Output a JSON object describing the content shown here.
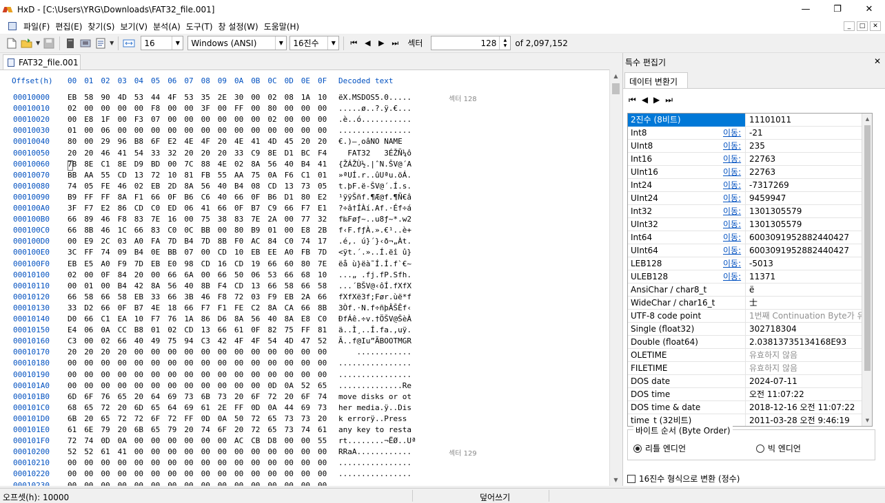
{
  "window": {
    "title": "HxD - [C:\\Users\\YRG\\Downloads\\FAT32_file.001]",
    "minimize": "—",
    "maximize": "❐",
    "close": "✕"
  },
  "menu": {
    "items": [
      "파일(F)",
      "편집(E)",
      "찾기(S)",
      "보기(V)",
      "분석(A)",
      "도구(T)",
      "창 설정(W)",
      "도움말(H)"
    ],
    "mdi": [
      "_",
      "□",
      "✕"
    ]
  },
  "toolbar": {
    "bytes_per_row": "16",
    "charset": "Windows (ANSI)",
    "offset_base": "16진수",
    "sector_label": "섹터",
    "sector_value": "128",
    "sector_total": "of 2,097,152"
  },
  "tab": {
    "label": "FAT32_file.001"
  },
  "hex": {
    "offset_header": "Offset(h)",
    "columns": [
      "00",
      "01",
      "02",
      "03",
      "04",
      "05",
      "06",
      "07",
      "08",
      "09",
      "0A",
      "0B",
      "0C",
      "0D",
      "0E",
      "0F"
    ],
    "decoded_header": "Decoded text",
    "rows": [
      {
        "off": "00010000",
        "b": "EB 58 90 4D 53 44 4F 53 35 2E 30 00 02 08 1A 10",
        "t": "ëX.MSDOS5.0.....",
        "s": "섹터 128"
      },
      {
        "off": "00010010",
        "b": "02 00 00 00 00 F8 00 00 3F 00 FF 00 80 00 00 00",
        "t": ".....ø..?.ÿ.€..."
      },
      {
        "off": "00010020",
        "b": "00 E8 1F 00 F3 07 00 00 00 00 00 00 02 00 00 00",
        "t": ".è..ó..........."
      },
      {
        "off": "00010030",
        "b": "01 00 06 00 00 00 00 00 00 00 00 00 00 00 00 00",
        "t": "................"
      },
      {
        "off": "00010040",
        "b": "80 00 29 96 B8 6F E2 4E 4F 20 4E 41 4D 45 20 20",
        "t": "€.)–¸oâNO NAME  "
      },
      {
        "off": "00010050",
        "b": "20 20 46 41 54 33 32 20 20 20 33 C9 8E D1 BC F4",
        "t": "  FAT32   3ÉŽÑ¼ô"
      },
      {
        "off": "00010060",
        "b": "7B 8E C1 8E D9 BD 00 7C 88 4E 02 8A 56 40 B4 41",
        "t": "{ŽÁŽÙ½.|ˆN.ŠV@´A"
      },
      {
        "off": "00010070",
        "b": "BB AA 55 CD 13 72 10 81 FB 55 AA 75 0A F6 C1 01",
        "t": "»ªUÍ.r..ûUªu.öÁ."
      },
      {
        "off": "00010080",
        "b": "74 05 FE 46 02 EB 2D 8A 56 40 B4 08 CD 13 73 05",
        "t": "t.þF.ë-ŠV@´.Í.s."
      },
      {
        "off": "00010090",
        "b": "B9 FF FF 8A F1 66 0F B6 C6 40 66 0F B6 D1 80 E2",
        "t": "¹ÿÿŠñf.¶Æ@f.¶Ñ€â"
      },
      {
        "off": "000100A0",
        "b": "3F F7 E2 86 CD C0 ED 06 41 66 0F B7 C9 66 F7 E1",
        "t": "?÷â†ÍÀí.Af.·Éf÷á"
      },
      {
        "off": "000100B0",
        "b": "66 89 46 F8 83 7E 16 00 75 38 83 7E 2A 00 77 32",
        "t": "f‰Føƒ~..u8ƒ~*.w2"
      },
      {
        "off": "000100C0",
        "b": "66 8B 46 1C 66 83 C0 0C BB 00 80 B9 01 00 E8 2B",
        "t": "f‹F.fƒÀ.».€¹..è+"
      },
      {
        "off": "000100D0",
        "b": "00 E9 2C 03 A0 FA 7D B4 7D 8B F0 AC 84 C0 74 17",
        "t": ".é,. ú}´}‹ð¬„Àt."
      },
      {
        "off": "000100E0",
        "b": "3C FF 74 09 B4 0E BB 07 00 CD 10 EB EE A0 FB 7D",
        "t": "<ÿt.´.»..Í.ëî û}"
      },
      {
        "off": "000100F0",
        "b": "EB E5 A0 F9 7D EB E0 98 CD 16 CD 19 66 60 80 7E",
        "t": "ëå ù}ëà˜Í.Í.f`€~"
      },
      {
        "off": "00010100",
        "b": "02 00 0F 84 20 00 66 6A 00 66 50 06 53 66 68 10",
        "t": "...„ .fj.fP.Sfh."
      },
      {
        "off": "00010110",
        "b": "00 01 00 B4 42 8A 56 40 8B F4 CD 13 66 58 66 58",
        "t": "...´BŠV@‹ôÍ.fXfX"
      },
      {
        "off": "00010120",
        "b": "66 58 66 58 EB 33 66 3B 46 F8 72 03 F9 EB 2A 66",
        "t": "fXfXë3f;Før.ùë*f"
      },
      {
        "off": "00010130",
        "b": "33 D2 66 0F B7 4E 18 66 F7 F1 FE C2 8A CA 66 8B",
        "t": "3Òf.·N.f÷ñþÂŠÊf‹"
      },
      {
        "off": "00010140",
        "b": "D0 66 C1 EA 10 F7 76 1A 86 D6 8A 56 40 8A E8 C0",
        "t": "ÐfÁê.÷v.†ÖŠV@ŠèÀ"
      },
      {
        "off": "00010150",
        "b": "E4 06 0A CC B8 01 02 CD 13 66 61 0F 82 75 FF 81",
        "t": "ä..Ì¸..Í.fa.‚uÿ."
      },
      {
        "off": "00010160",
        "b": "C3 00 02 66 40 49 75 94 C3 42 4F 4F 54 4D 47 52",
        "t": "Ã..f@Iu”ÃBOOTMGR"
      },
      {
        "off": "00010170",
        "b": "20 20 20 20 00 00 00 00 00 00 00 00 00 00 00 00",
        "t": "    ............"
      },
      {
        "off": "00010180",
        "b": "00 00 00 00 00 00 00 00 00 00 00 00 00 00 00 00",
        "t": "................"
      },
      {
        "off": "00010190",
        "b": "00 00 00 00 00 00 00 00 00 00 00 00 00 00 00 00",
        "t": "................"
      },
      {
        "off": "000101A0",
        "b": "00 00 00 00 00 00 00 00 00 00 00 00 0D 0A 52 65",
        "t": "..............Re"
      },
      {
        "off": "000101B0",
        "b": "6D 6F 76 65 20 64 69 73 6B 73 20 6F 72 20 6F 74",
        "t": "move disks or ot"
      },
      {
        "off": "000101C0",
        "b": "68 65 72 20 6D 65 64 69 61 2E FF 0D 0A 44 69 73",
        "t": "her media.ÿ..Dis"
      },
      {
        "off": "000101D0",
        "b": "6B 20 65 72 72 6F 72 FF 0D 0A 50 72 65 73 73 20",
        "t": "k errorÿ..Press "
      },
      {
        "off": "000101E0",
        "b": "61 6E 79 20 6B 65 79 20 74 6F 20 72 65 73 74 61",
        "t": "any key to resta"
      },
      {
        "off": "000101F0",
        "b": "72 74 0D 0A 00 00 00 00 00 00 AC CB D8 00 00 55 AA",
        "t": "rt........¬ËØ..Uª"
      },
      {
        "off": "00010200",
        "b": "52 52 61 41 00 00 00 00 00 00 00 00 00 00 00 00",
        "t": "RRaA............",
        "s": "섹터 129"
      },
      {
        "off": "00010210",
        "b": "00 00 00 00 00 00 00 00 00 00 00 00 00 00 00 00",
        "t": "................"
      },
      {
        "off": "00010220",
        "b": "00 00 00 00 00 00 00 00 00 00 00 00 00 00 00 00",
        "t": "................"
      },
      {
        "off": "00010230",
        "b": "00 00 00 00 00 00 00 00 00 00 00 00 00 00 00 00",
        "t": "................"
      }
    ]
  },
  "panel": {
    "title": "특수 편집기",
    "close": "✕",
    "tab": "데이터 변환기",
    "goto": "이동:",
    "rows": [
      {
        "name": "2진수 (8비트)",
        "value": "11101011",
        "sel": true
      },
      {
        "name": "Int8",
        "value": "-21",
        "link": true
      },
      {
        "name": "UInt8",
        "value": "235",
        "link": true
      },
      {
        "name": "Int16",
        "value": "22763",
        "link": true
      },
      {
        "name": "UInt16",
        "value": "22763",
        "link": true
      },
      {
        "name": "Int24",
        "value": "-7317269",
        "link": true
      },
      {
        "name": "UInt24",
        "value": "9459947",
        "link": true
      },
      {
        "name": "Int32",
        "value": "1301305579",
        "link": true
      },
      {
        "name": "UInt32",
        "value": "1301305579",
        "link": true
      },
      {
        "name": "Int64",
        "value": "6003091952882440427",
        "link": true
      },
      {
        "name": "UInt64",
        "value": "6003091952882440427",
        "link": true
      },
      {
        "name": "LEB128",
        "value": "-5013",
        "link": true
      },
      {
        "name": "ULEB128",
        "value": "11371",
        "link": true
      },
      {
        "name": "AnsiChar / char8_t",
        "value": "ë"
      },
      {
        "name": "WideChar / char16_t",
        "value": "士"
      },
      {
        "name": "UTF-8 code point",
        "value": "1번째 Continuation Byte가 유효",
        "dim": true
      },
      {
        "name": "Single (float32)",
        "value": "302718304"
      },
      {
        "name": "Double (float64)",
        "value": "2.03813735134168E93"
      },
      {
        "name": "OLETIME",
        "value": "유효하지 않음",
        "dim": true
      },
      {
        "name": "FILETIME",
        "value": "유효하지 않음",
        "dim": true
      },
      {
        "name": "DOS date",
        "value": "2024-07-11"
      },
      {
        "name": "DOS time",
        "value": "오전 11:07:22"
      },
      {
        "name": "DOS time & date",
        "value": "2018-12-16 오전 11:07:22"
      },
      {
        "name": "time_t (32비트)",
        "value": "2011-03-28 오전 9:46:19"
      },
      {
        "name": "time_t (64비트)",
        "value": "유효하지 않음",
        "dim": true
      }
    ],
    "byte_order_label": "바이트 순서 (Byte Order)",
    "little_endian": "리틀 엔디언",
    "big_endian": "빅 엔디언",
    "hex_checkbox": "16진수 형식으로 변환 (정수)"
  },
  "status": {
    "offset": "오프셋(h): 10000",
    "mode": "덮어쓰기"
  }
}
